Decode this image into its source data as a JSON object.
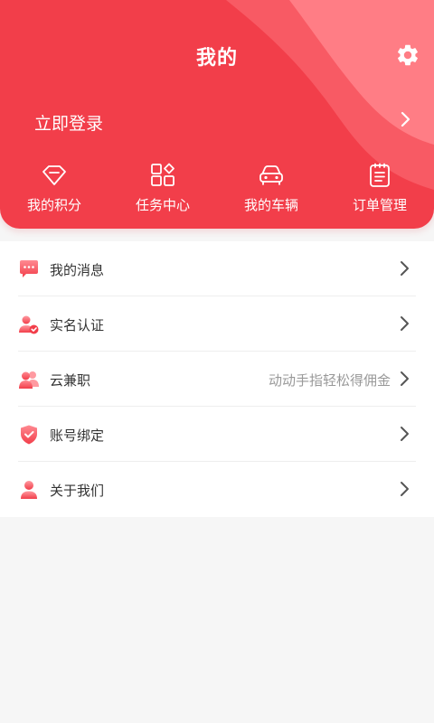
{
  "header": {
    "title": "我的",
    "settings_icon": "gear-icon",
    "login_label": "立即登录",
    "login_icon": "chevron-right-icon",
    "colors": {
      "primary": "#f23e4a",
      "wave_light": "#ff7d85",
      "wave_mid": "#f85a64"
    }
  },
  "quick_actions": [
    {
      "label": "我的积分",
      "icon": "diamond-icon"
    },
    {
      "label": "任务中心",
      "icon": "grid-icon"
    },
    {
      "label": "我的车辆",
      "icon": "car-icon"
    },
    {
      "label": "订单管理",
      "icon": "clipboard-icon"
    }
  ],
  "menu": [
    {
      "label": "我的消息",
      "hint": "",
      "icon": "message-icon"
    },
    {
      "label": "实名认证",
      "hint": "",
      "icon": "verify-user-icon"
    },
    {
      "label": "云兼职",
      "hint": "动动手指轻松得佣金",
      "icon": "users-icon"
    },
    {
      "label": "账号绑定",
      "hint": "",
      "icon": "shield-check-icon"
    },
    {
      "label": "关于我们",
      "hint": "",
      "icon": "person-icon"
    }
  ]
}
